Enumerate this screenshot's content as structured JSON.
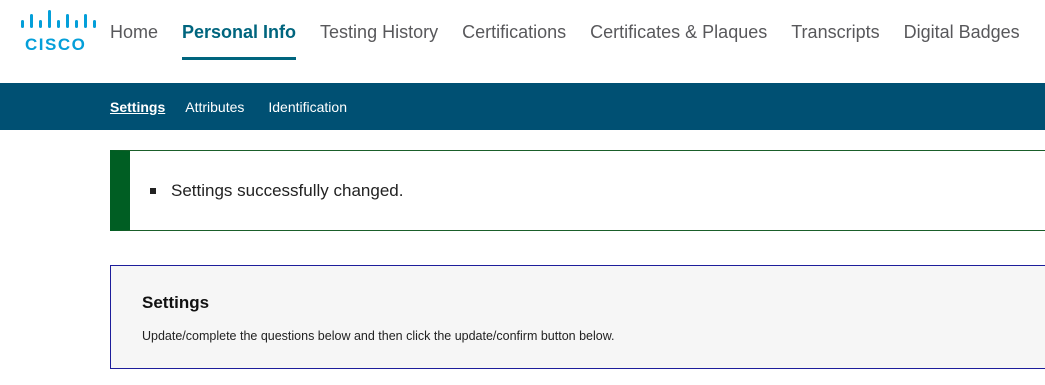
{
  "logo": {
    "text": "CISCO"
  },
  "nav": {
    "items": [
      {
        "label": "Home"
      },
      {
        "label": "Personal Info"
      },
      {
        "label": "Testing History"
      },
      {
        "label": "Certifications"
      },
      {
        "label": "Certificates & Plaques"
      },
      {
        "label": "Transcripts"
      },
      {
        "label": "Digital Badges"
      }
    ],
    "active": "Personal Info"
  },
  "subnav": {
    "items": [
      {
        "label": "Settings"
      },
      {
        "label": "Attributes"
      },
      {
        "label": "Identification"
      }
    ],
    "active": "Settings"
  },
  "alert": {
    "messages": [
      "Settings successfully changed."
    ]
  },
  "panel": {
    "title": "Settings",
    "description": "Update/complete the questions below and then click the update/confirm button below."
  },
  "colors": {
    "brand_blue": "#049fd9",
    "nav_active": "#00657e",
    "subbar_bg": "#005073",
    "success_green": "#005e23",
    "panel_border": "#1d1d9b"
  }
}
